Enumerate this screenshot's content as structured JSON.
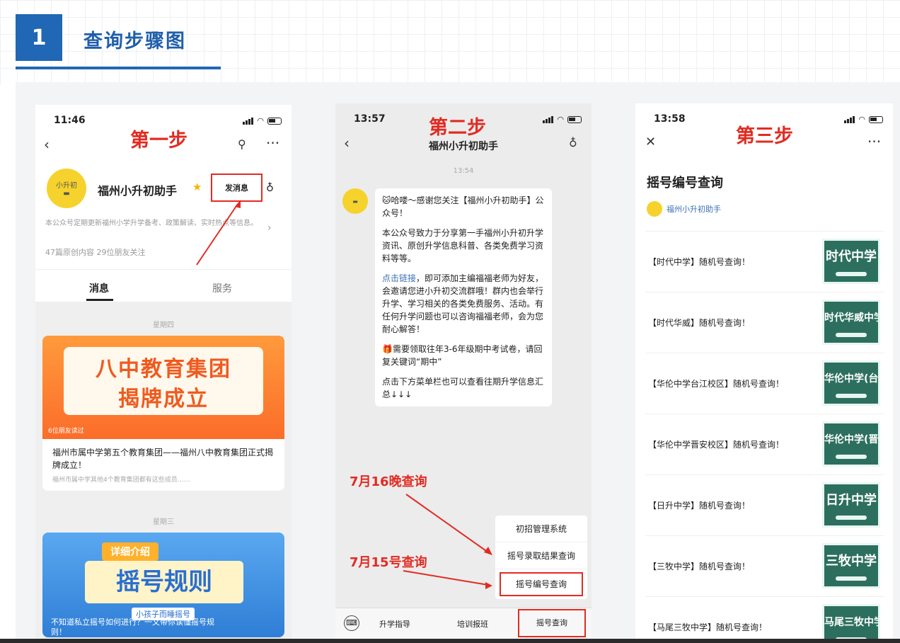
{
  "section": {
    "number": "1",
    "title": "查询步骤图"
  },
  "phone1": {
    "time": "11:46",
    "step": "第一步",
    "account": "福州小升初助手",
    "logo_text": "小升初",
    "message_button": "发消息",
    "desc": "本公众号定期更新福州小学升学备考、政策解读、实时热点等信息。",
    "stats": "47篇原创内容   29位朋友关注",
    "tabs": [
      "消息",
      "服务"
    ],
    "day1": "星期四",
    "card1": {
      "cover_line1": "八中教育集团",
      "cover_line2": "揭牌成立",
      "readers": "6位朋友读过",
      "title": "福州市属中学第五个教育集团——福州八中教育集团正式揭牌成立！",
      "sub": "福州市属中学其他4个教育集团都有这些成员……"
    },
    "day2": "星期三",
    "card2": {
      "tag": "详细介绍",
      "big": "摇号规则",
      "sub": "小孩子而睡摇号",
      "cap1": "不知道私立摇号如何进行？一文带你读懂摇号规",
      "cap2": "则！"
    }
  },
  "phone2": {
    "time": "13:57",
    "step": "第二步",
    "title": "福州小升初助手",
    "timestamp": "13:54",
    "msg_p1": "🐱哈喽～感谢您关注【福州小升初助手】公众号！",
    "msg_p2": "本公众号致力于分享第一手福州小升初升学资讯、原创升学信息科普、各类免费学习资料等等。",
    "msg_link": "点击链接",
    "msg_p3": "，即可添加主编福福老师为好友，会邀请您进小升初交流群哦！群内也会举行升学、学习相关的各类免费服务、活动。有任何升学问题也可以咨询福福老师，会为您耐心解答！",
    "msg_p4": "🎁需要领取往年3-6年级期中考试卷，请回复关键词“期中”",
    "msg_p5": "点击下方菜单栏也可以查看往期升学信息汇总↓↓↓",
    "note1": "7月16晚查询",
    "note2": "7月15号查询",
    "menu": [
      "初招管理系统",
      "摇号录取结果查询",
      "摇号编号查询"
    ],
    "bottom": [
      "升学指导",
      "培训报班",
      "摇号查询"
    ]
  },
  "phone3": {
    "time": "13:58",
    "step": "第三步",
    "title": "摇号编号查询",
    "account": "福州小升初助手",
    "rows": [
      {
        "text": "【时代中学】随机号查询！",
        "thumb": "时代中学"
      },
      {
        "text": "【时代华威】随机号查询！",
        "thumb": "时代华威中学"
      },
      {
        "text": "【华伦中学台江校区】随机号查询！",
        "thumb": "华伦中学(台江"
      },
      {
        "text": "【华伦中学晋安校区】随机号查询！",
        "thumb": "华伦中学(晋安"
      },
      {
        "text": "【日升中学】随机号查询！",
        "thumb": "日升中学"
      },
      {
        "text": "【三牧中学】随机号查询！",
        "thumb": "三牧中学"
      },
      {
        "text": "【马尾三牧中学】随机号查询！",
        "thumb": "马尾三牧中学"
      }
    ]
  },
  "colors": {
    "accent": "#2067b5",
    "highlight": "#e22b22"
  }
}
